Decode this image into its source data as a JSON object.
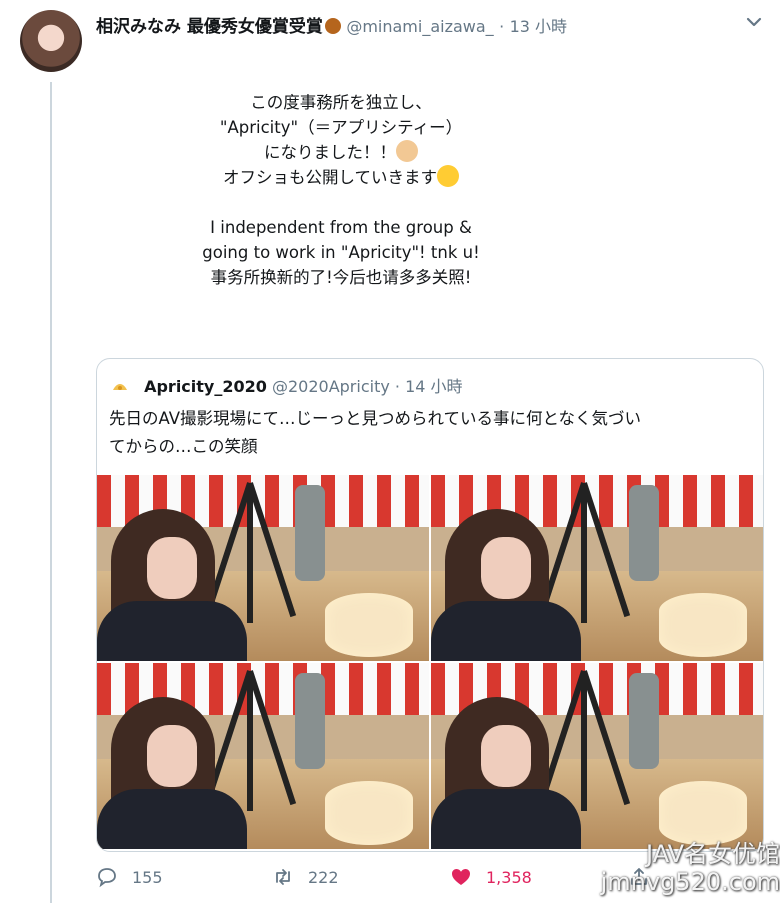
{
  "tweet": {
    "display_name": "相沢みなみ 最優秀女優賞受賞",
    "handle": "@minami_aizawa_",
    "separator": "·",
    "time": "13 小時",
    "lines": [
      "この度事務所を独立し、",
      "\"Apricity\"（＝アプリシティー）",
      "になりました！！",
      "オフショも公開していきます",
      "",
      "I independent from the group &",
      "going to work in \"Apricity\"! tnk u!",
      "事务所换新的了!今后也请多多关照!"
    ],
    "emoji": [
      "bear-emoji",
      "clap-emoji",
      "wink-emoji"
    ]
  },
  "quote": {
    "name": "Apricity_2020",
    "handle": "@2020Apricity",
    "separator": "·",
    "time": "14 小時",
    "text_line1": "先日のAV撮影現場にて…じーっと見つめられている事に何となく気づい",
    "text_line2": "てからの…この笑顔",
    "photos": [
      "photo-1",
      "photo-2",
      "photo-3",
      "photo-4"
    ]
  },
  "actions": {
    "replies": "155",
    "retweets": "222",
    "likes": "1,358"
  },
  "watermark": {
    "line1": "JAV名女优馆",
    "line2": "jmnvg520.com"
  },
  "colors": {
    "text": "#14171a",
    "secondary": "#657786",
    "border": "#ccd6dd",
    "like": "#e0245e"
  }
}
